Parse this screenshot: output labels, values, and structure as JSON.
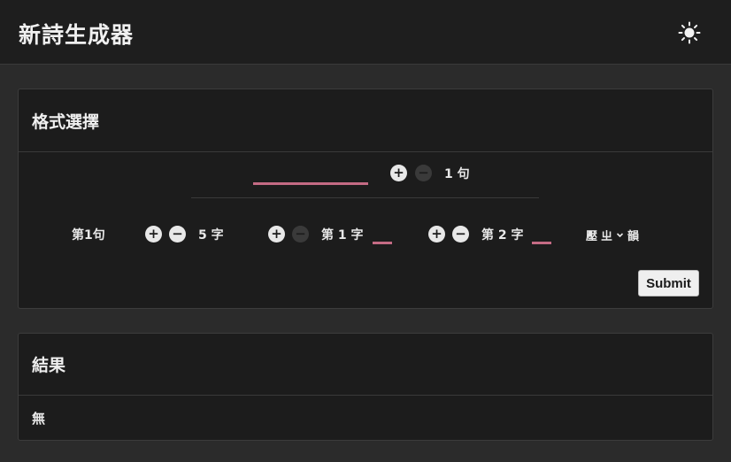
{
  "header": {
    "title": "新詩生成器",
    "theme_icon": "sun-icon"
  },
  "format_card": {
    "title": "格式選擇",
    "line_count_label": "1 句",
    "rows": [
      {
        "row_label": "第1句",
        "char_count_label": "5 字",
        "rhyme_positions": [
          {
            "label": "第 1 字"
          },
          {
            "label": "第 2 字"
          }
        ],
        "rhyme_select": {
          "selected": "ㄓ",
          "prefix": "壓",
          "suffix": "韻"
        }
      }
    ],
    "submit_label": "Submit"
  },
  "result_card": {
    "title": "結果",
    "text": "無"
  },
  "colors": {
    "accent_underline": "#c46b84",
    "bg": "#2b2b2b",
    "card": "#1c1c1c"
  }
}
